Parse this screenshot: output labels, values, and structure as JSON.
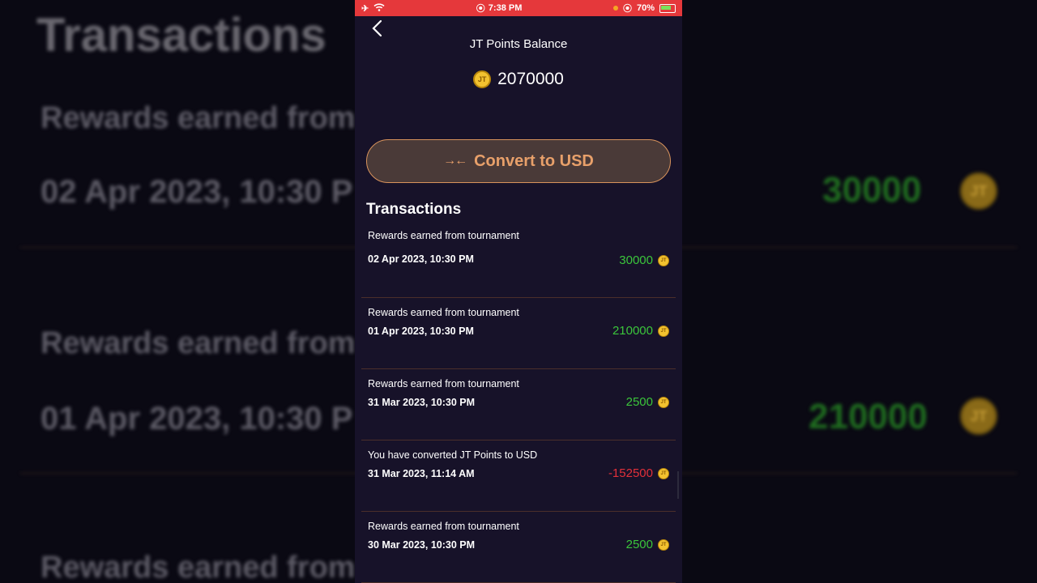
{
  "background": {
    "title": "Transactions",
    "rows": [
      {
        "desc": "Rewards earned from",
        "date": "02 Apr 2023, 10:30 P",
        "amount": "30000"
      },
      {
        "desc": "Rewards earned from",
        "date": "01 Apr 2023, 10:30 P",
        "amount": "210000"
      },
      {
        "desc": "Rewards earned from"
      }
    ],
    "coin_label": "JT"
  },
  "status": {
    "time": "7:38 PM",
    "battery": "70%"
  },
  "balance": {
    "title": "JT Points Balance",
    "value": "2070000",
    "coin_label": "JT"
  },
  "convert_button": {
    "label": "Convert to USD"
  },
  "transactions": {
    "title": "Transactions",
    "items": [
      {
        "desc": "Rewards earned from tournament",
        "date": "02 Apr 2023, 10:30 PM",
        "amount": "30000",
        "type": "credit"
      },
      {
        "desc": "Rewards earned from tournament",
        "date": "01 Apr 2023, 10:30 PM",
        "amount": "210000",
        "type": "credit"
      },
      {
        "desc": "Rewards earned from tournament",
        "date": "31 Mar 2023, 10:30 PM",
        "amount": "2500",
        "type": "credit"
      },
      {
        "desc": "You have converted JT Points to USD",
        "date": "31 Mar 2023, 11:14 AM",
        "amount": "-152500",
        "type": "debit"
      },
      {
        "desc": "Rewards earned from tournament",
        "date": "30 Mar 2023, 10:30 PM",
        "amount": "2500",
        "type": "credit"
      }
    ]
  },
  "colors": {
    "status_bar": "#e5383b",
    "panel": "#171229",
    "credit": "#3bc53b",
    "debit": "#e2303a",
    "accent": "#e8a06a"
  }
}
